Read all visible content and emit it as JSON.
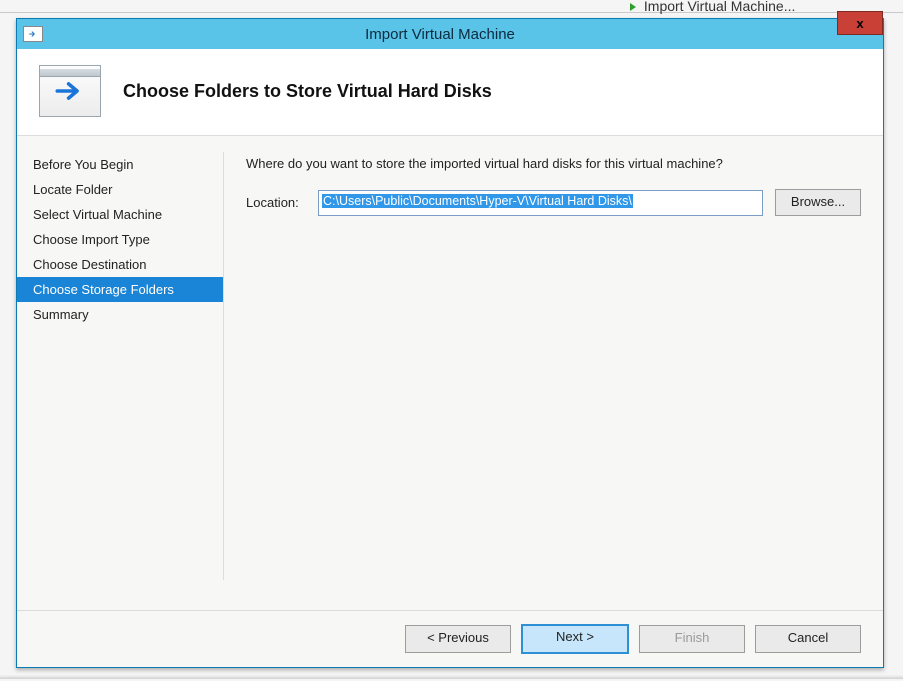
{
  "background": {
    "truncated_text_top": "",
    "action_text": "Import Virtual Machine..."
  },
  "dialog": {
    "title": "Import Virtual Machine",
    "close_glyph": "x",
    "header_title": "Choose Folders to Store Virtual Hard Disks"
  },
  "sidebar": {
    "items": [
      {
        "label": "Before You Begin",
        "selected": false
      },
      {
        "label": "Locate Folder",
        "selected": false
      },
      {
        "label": "Select Virtual Machine",
        "selected": false
      },
      {
        "label": "Choose Import Type",
        "selected": false
      },
      {
        "label": "Choose Destination",
        "selected": false
      },
      {
        "label": "Choose Storage Folders",
        "selected": true
      },
      {
        "label": "Summary",
        "selected": false
      }
    ]
  },
  "content": {
    "prompt": "Where do you want to store the imported virtual hard disks for this virtual machine?",
    "location_label": "Location:",
    "location_value": "C:\\Users\\Public\\Documents\\Hyper-V\\Virtual Hard Disks\\",
    "browse_label": "Browse..."
  },
  "footer": {
    "previous": "< Previous",
    "next": "Next >",
    "finish": "Finish",
    "cancel": "Cancel"
  }
}
